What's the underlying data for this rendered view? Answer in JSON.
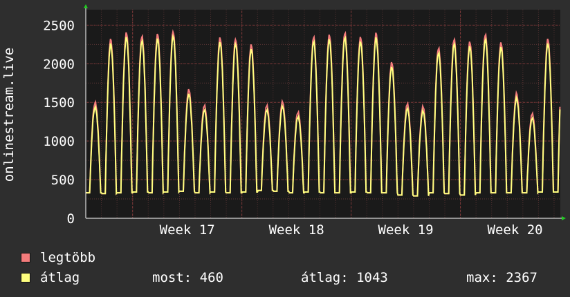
{
  "chart_data": {
    "type": "line",
    "ylabel": "onlinestream.live",
    "ylim": [
      0,
      2700
    ],
    "yticks": [
      0,
      500,
      1000,
      1500,
      2000,
      2500
    ],
    "x_range_days": [
      0,
      30.4
    ],
    "xticks": [
      {
        "label": "Week 17",
        "at_day": 6.5
      },
      {
        "label": "Week 18",
        "at_day": 13.5
      },
      {
        "label": "Week 19",
        "at_day": 20.5
      },
      {
        "label": "Week 20",
        "at_day": 27.5
      }
    ],
    "grid": true,
    "daily_peaks": [
      1450,
      2250,
      2340,
      2300,
      2330,
      2360,
      1600,
      1400,
      2280,
      2260,
      2180,
      1400,
      1450,
      1320,
      2280,
      2310,
      2340,
      2290,
      2330,
      1950,
      1420,
      1390,
      2150,
      2250,
      2220,
      2320,
      2220,
      1550,
      1290,
      2260
    ],
    "daily_troughs": [
      330,
      320,
      330,
      340,
      330,
      340,
      350,
      330,
      340,
      330,
      340,
      360,
      350,
      330,
      340,
      330,
      330,
      340,
      330,
      330,
      300,
      290,
      330,
      320,
      300,
      330,
      330,
      330,
      330,
      340
    ],
    "max_offset": 60,
    "series": [
      {
        "name": "legtöbb",
        "color": "#f47c7c"
      },
      {
        "name": "átlag",
        "color": "#ffff7f"
      }
    ]
  },
  "legend": {
    "max_label": "legtöbb",
    "avg_label": "átlag",
    "current": "most: 460",
    "average": "átlag: 1043",
    "maximum": "max: 2367"
  },
  "colors": {
    "background": "#2e2e2e",
    "plot_background": "#1a1a1a",
    "grid": "#5a3535",
    "axis": "#ffffff",
    "arrow": "#22cc22"
  }
}
